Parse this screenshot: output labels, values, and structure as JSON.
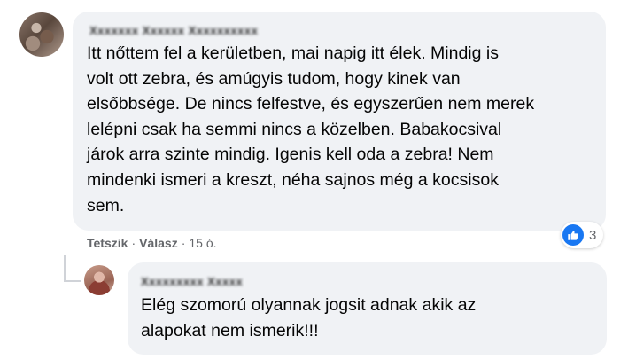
{
  "comments": [
    {
      "author": "Xxxxxxx Xxxxxx Xxxxxxxxxx",
      "lines": [
        "Itt nőttem fel a kerületben, mai napig itt élek. Mindig is",
        "volt ott zebra, és amúgyis tudom, hogy kinek van",
        "elsőbbsége. De nincs felfestve, és egyszerűen nem merek",
        "lelépni csak ha semmi nincs a közelben. Babakocsival",
        "járok arra szinte mindig. Igenis kell oda a zebra! Nem",
        "mindenki ismeri a kreszt, néha sajnos még a kocsisok",
        "sem."
      ]
    },
    {
      "author": "Xxxxxxxxx Xxxxx",
      "lines": [
        "Elég szomorú olyannak jogsit adnak akik az",
        "alapokat nem ismerik!!!"
      ]
    }
  ],
  "actions": {
    "like": "Tetszik",
    "reply": "Válasz",
    "separator": "·",
    "time": "15 ó."
  },
  "reactions": {
    "icon": "thumbs-up-icon",
    "count": "3",
    "color": "#1877f2"
  }
}
